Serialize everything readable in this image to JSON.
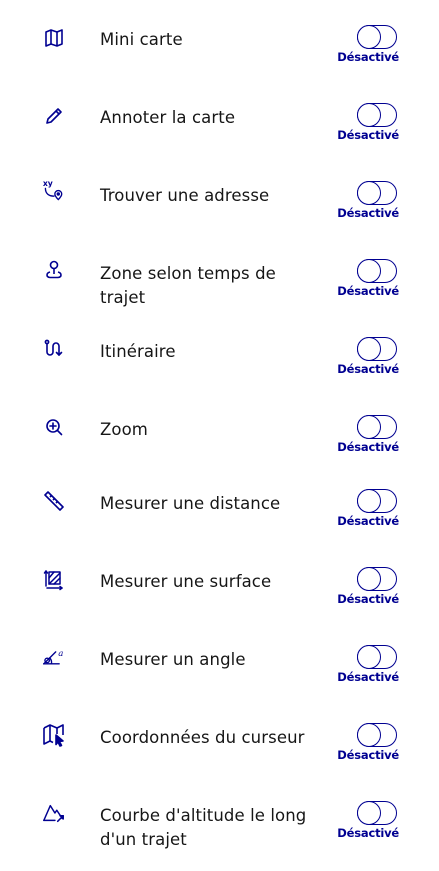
{
  "colors": {
    "accent": "#000091",
    "text": "#161616",
    "background": "#ffffff"
  },
  "tools": [
    {
      "icon": "map-icon",
      "label": "Mini carte",
      "state": "Désactivé",
      "enabled": false
    },
    {
      "icon": "pencil-icon",
      "label": "Annoter la carte",
      "state": "Désactivé",
      "enabled": false
    },
    {
      "icon": "xy-location-icon",
      "label": "Trouver une adresse",
      "state": "Désactivé",
      "enabled": false
    },
    {
      "icon": "map-pin-user-icon",
      "label": "Zone selon temps de trajet",
      "state": "Désactivé",
      "enabled": false
    },
    {
      "icon": "route-icon",
      "label": "Itinéraire",
      "state": "Désactivé",
      "enabled": false
    },
    {
      "icon": "zoom-in-icon",
      "label": "Zoom",
      "state": "Désactivé",
      "enabled": false
    },
    {
      "icon": "ruler-icon",
      "label": "Mesurer une distance",
      "state": "Désactivé",
      "enabled": false
    },
    {
      "icon": "area-measure-icon",
      "label": "Mesurer une surface",
      "state": "Désactivé",
      "enabled": false
    },
    {
      "icon": "angle-measure-icon",
      "label": "Mesurer un angle",
      "state": "Désactivé",
      "enabled": false
    },
    {
      "icon": "map-cursor-icon",
      "label": "Coordonnées du curseur",
      "state": "Désactivé",
      "enabled": false
    },
    {
      "icon": "elevation-profile-icon",
      "label": "Courbe d'altitude le long d'un trajet",
      "state": "Désactivé",
      "enabled": false
    }
  ]
}
